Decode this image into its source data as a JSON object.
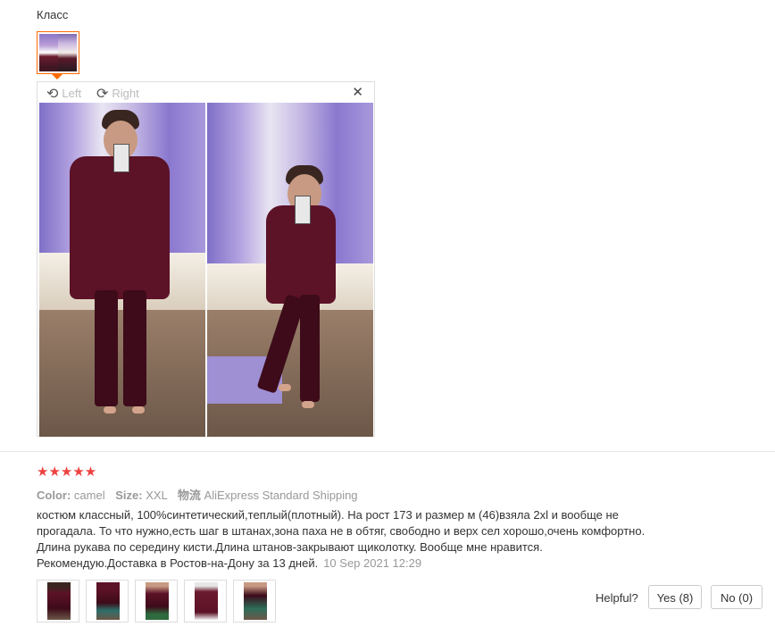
{
  "review": {
    "title": "Класс",
    "stars": "★★★★★",
    "rating": 5,
    "meta": {
      "color_label": "Color:",
      "color_value": "camel",
      "size_label": "Size:",
      "size_value": "XXL",
      "shipping_label": "物流",
      "shipping_value": "AliExpress Standard Shipping"
    },
    "text_lines": [
      "костюм классный, 100%синтетический,теплый(плотный). На рост 173 и размер м (46)взяла 2xl и вообще не",
      "прогадала. То что нужно,есть шаг в штанах,зона паха не в обтяг, свободно и верх сел хорошо,очень комфортно.",
      "Длина рукава по середину кисти.Длина штанов-закрывают щиколотку. Вообще мне нравится.",
      "Рекомендую.Доставка в Ростов-на-Дону за 13 дней."
    ],
    "date": "10 Sep 2021 12:29"
  },
  "viewer": {
    "rotate_left_label": "Left",
    "rotate_right_label": "Right",
    "close_symbol": "✕"
  },
  "helpful": {
    "label": "Helpful?",
    "yes_label": "Yes (8)",
    "no_label": "No (0)"
  },
  "colors": {
    "accent": "#ff6a00",
    "star": "#ef4141",
    "muted": "#999999",
    "hoodie": "#5c1227"
  }
}
